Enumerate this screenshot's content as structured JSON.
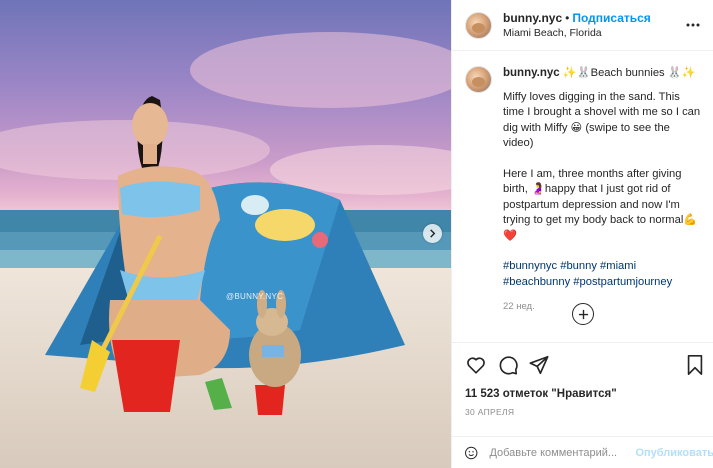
{
  "photo": {
    "watermark": "@BUNNY.NYC",
    "next_icon": "chevron-right-icon"
  },
  "header": {
    "username": "bunny.nyc",
    "separator": "•",
    "follow_label": "Подписаться",
    "location": "Miami Beach, Florida",
    "more_icon": "more-horizontal-icon"
  },
  "caption": {
    "username": "bunny.nyc",
    "title": "✨🐰Beach bunnies 🐰✨",
    "para1": "Miffy loves digging in the sand. This time I brought a shovel with me so I can dig with Miffy 😀 (swipe to see the video)",
    "para2": "Here I am, three months after giving birth, 🤰happy that I just got rid of postpartum depression and now I'm trying to get my body back to normal💪 ❤️",
    "hashtags": "#bunnynyc #bunny #miami #beachbunny #postpartumjourney",
    "time": "22 нед."
  },
  "load_more_icon": "plus-circle-icon",
  "actions": {
    "like_icon": "heart-icon",
    "comment_icon": "comment-icon",
    "share_icon": "send-icon",
    "save_icon": "bookmark-icon"
  },
  "likes_text": "11 523 отметок \"Нравится\"",
  "date": "30 АПРЕЛЯ",
  "comment": {
    "emoji_icon": "smiley-icon",
    "placeholder": "Добавьте комментарий...",
    "publish_label": "Опубликовать"
  },
  "colors": {
    "accent": "#0095f6",
    "publish_disabled": "#b2dffc",
    "hashtag": "#00376b",
    "muted": "#8e8e8e"
  }
}
